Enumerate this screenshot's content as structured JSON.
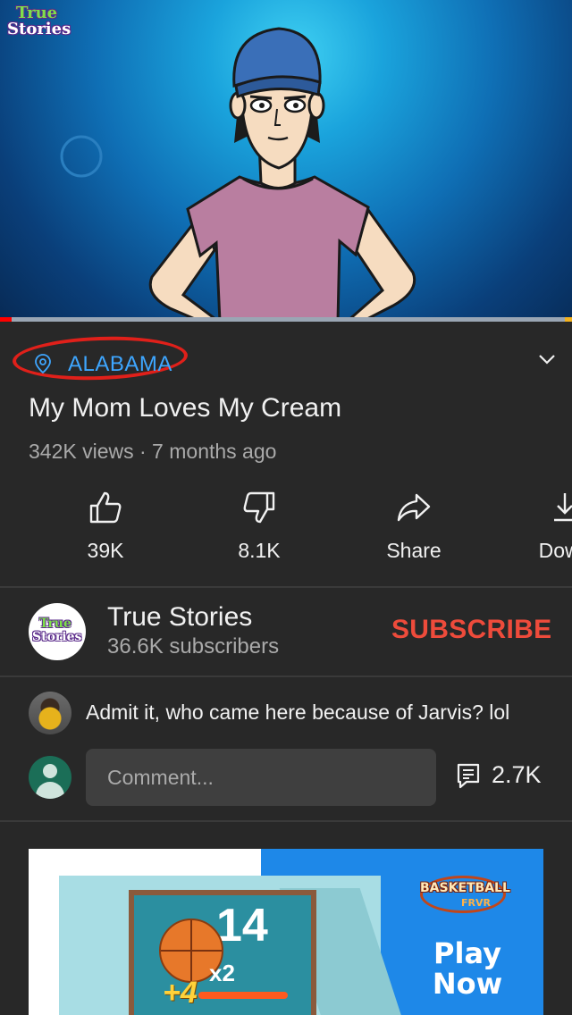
{
  "video": {
    "logo_line1": "True",
    "logo_line2": "Stories",
    "progress_played_fraction": 0.02
  },
  "location": {
    "text": "ALABAMA"
  },
  "title": "My Mom Loves My Cream",
  "meta": "342K views · 7 months ago",
  "actions": [
    {
      "icon": "thumbs-up-icon",
      "label": "39K"
    },
    {
      "icon": "thumbs-down-icon",
      "label": "8.1K"
    },
    {
      "icon": "share-icon",
      "label": "Share"
    },
    {
      "icon": "download-icon",
      "label": "Down"
    }
  ],
  "channel": {
    "avatar_line1": "True",
    "avatar_line2": "Stories",
    "name": "True Stories",
    "subscribers": "36.6K subscribers",
    "subscribe_label": "SUBSCRIBE"
  },
  "comments": {
    "top_comment": "Admit it, who came here because of Jarvis? lol",
    "input_placeholder": "Comment...",
    "count": "2.7K"
  },
  "ad": {
    "score": "14",
    "bonus": "+4",
    "multiplier": "x2",
    "brand_line1": "BASKETBALL",
    "brand_line2": "FRVR",
    "cta": "Play Now"
  },
  "colors": {
    "accent_blue": "#3ea6ff",
    "subscribe_red": "#ee4b3b",
    "background": "#282828",
    "annotation_red": "#e0201a"
  }
}
